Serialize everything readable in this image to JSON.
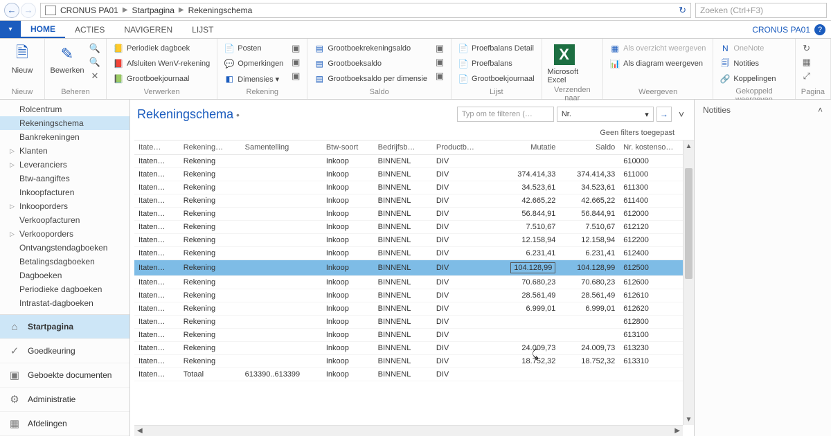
{
  "titlebar": {
    "company": "CRONUS PA01",
    "crumbs": [
      "Startpagina",
      "Rekeningschema"
    ],
    "search_placeholder": "Zoeken (Ctrl+F3)"
  },
  "tabs": {
    "menu": "▾",
    "items": [
      "HOME",
      "ACTIES",
      "NAVIGEREN",
      "LIJST"
    ],
    "right_company": "CRONUS PA01"
  },
  "ribbon": {
    "groups": [
      {
        "label": "Nieuw",
        "big": [
          {
            "icon": "🗎",
            "text": "Nieuw"
          }
        ]
      },
      {
        "label": "Beheren",
        "big": [
          {
            "icon": "✎",
            "text": "Bewerken"
          }
        ],
        "icons": [
          "🔍",
          "🔍",
          "✕"
        ]
      },
      {
        "label": "Verwerken",
        "small": [
          {
            "icon": "📒",
            "text": "Periodiek dagboek"
          },
          {
            "icon": "📕",
            "text": "Afsluiten WenV-rekening"
          },
          {
            "icon": "📗",
            "text": "Grootboekjournaal"
          }
        ]
      },
      {
        "label": "Rekening",
        "small": [
          {
            "icon": "📄",
            "text": "Posten"
          },
          {
            "icon": "💬",
            "text": "Opmerkingen"
          },
          {
            "icon": "◧",
            "text": "Dimensies ▾"
          }
        ],
        "icons": [
          "▣",
          "▣",
          "▣"
        ]
      },
      {
        "label": "Saldo",
        "small": [
          {
            "icon": "▤",
            "text": "Grootboekrekeningsaldo"
          },
          {
            "icon": "▤",
            "text": "Grootboeksaldo"
          },
          {
            "icon": "▤",
            "text": "Grootboeksaldo per dimensie"
          }
        ],
        "icons": [
          "▣",
          "▣",
          "▣"
        ]
      },
      {
        "label": "Lijst",
        "small": [
          {
            "icon": "📄",
            "text": "Proefbalans Detail"
          },
          {
            "icon": "📄",
            "text": "Proefbalans"
          },
          {
            "icon": "📄",
            "text": "Grootboekjournaal"
          }
        ]
      },
      {
        "label": "Verzenden naar",
        "big": [
          {
            "icon": "X",
            "text": "Microsoft Excel",
            "excel": true
          }
        ]
      },
      {
        "label": "Weergeven",
        "small": [
          {
            "icon": "▦",
            "text": "Als overzicht weergeven",
            "dim": true
          },
          {
            "icon": "📊",
            "text": "Als diagram weergeven"
          }
        ]
      },
      {
        "label": "Gekoppeld weergeven",
        "small": [
          {
            "icon": "N",
            "text": "OneNote",
            "dim": true
          },
          {
            "icon": "🗐",
            "text": "Notities"
          },
          {
            "icon": "🔗",
            "text": "Koppelingen"
          }
        ]
      },
      {
        "label": "Pagina",
        "iconsCol": [
          "↻",
          "▦",
          "⤢"
        ]
      }
    ]
  },
  "sidebar": {
    "items": [
      {
        "label": "Rolcentrum"
      },
      {
        "label": "Rekeningschema",
        "sel": true
      },
      {
        "label": "Bankrekeningen"
      },
      {
        "label": "Klanten",
        "caret": true
      },
      {
        "label": "Leveranciers",
        "caret": true
      },
      {
        "label": "Btw-aangiftes"
      },
      {
        "label": "Inkoopfacturen"
      },
      {
        "label": "Inkooporders",
        "caret": true
      },
      {
        "label": "Verkoopfacturen"
      },
      {
        "label": "Verkooporders",
        "caret": true
      },
      {
        "label": "Ontvangstendagboeken"
      },
      {
        "label": "Betalingsdagboeken"
      },
      {
        "label": "Dagboeken"
      },
      {
        "label": "Periodieke dagboeken"
      },
      {
        "label": "Intrastat-dagboeken"
      }
    ],
    "bottom": [
      {
        "icon": "⌂",
        "label": "Startpagina",
        "sel": true
      },
      {
        "icon": "✓",
        "label": "Goedkeuring"
      },
      {
        "icon": "▣",
        "label": "Geboekte documenten"
      },
      {
        "icon": "⚙",
        "label": "Administratie"
      },
      {
        "icon": "▦",
        "label": "Afdelingen"
      }
    ]
  },
  "page": {
    "title": "Rekeningschema",
    "filter_placeholder": "Typ om te filteren (…",
    "filter_field": "Nr.",
    "no_filters": "Geen filters toegepast"
  },
  "columns": [
    "Itate…",
    "Rekening…",
    "Samentelling",
    "Btw-soort",
    "Bedrijfsb…",
    "Productb…",
    "Mutatie",
    "Saldo",
    "Nr. kostenso…"
  ],
  "rows": [
    {
      "c": [
        "Itaten…",
        "Rekening",
        "",
        "Inkoop",
        "BINNENL",
        "DIV",
        "",
        "",
        "610000"
      ]
    },
    {
      "c": [
        "Itaten…",
        "Rekening",
        "",
        "Inkoop",
        "BINNENL",
        "DIV",
        "374.414,33",
        "374.414,33",
        "611000"
      ]
    },
    {
      "c": [
        "Itaten…",
        "Rekening",
        "",
        "Inkoop",
        "BINNENL",
        "DIV",
        "34.523,61",
        "34.523,61",
        "611300"
      ]
    },
    {
      "c": [
        "Itaten…",
        "Rekening",
        "",
        "Inkoop",
        "BINNENL",
        "DIV",
        "42.665,22",
        "42.665,22",
        "611400"
      ]
    },
    {
      "c": [
        "Itaten…",
        "Rekening",
        "",
        "Inkoop",
        "BINNENL",
        "DIV",
        "56.844,91",
        "56.844,91",
        "612000"
      ]
    },
    {
      "c": [
        "Itaten…",
        "Rekening",
        "",
        "Inkoop",
        "BINNENL",
        "DIV",
        "7.510,67",
        "7.510,67",
        "612120"
      ]
    },
    {
      "c": [
        "Itaten…",
        "Rekening",
        "",
        "Inkoop",
        "BINNENL",
        "DIV",
        "12.158,94",
        "12.158,94",
        "612200"
      ]
    },
    {
      "c": [
        "Itaten…",
        "Rekening",
        "",
        "Inkoop",
        "BINNENL",
        "DIV",
        "6.231,41",
        "6.231,41",
        "612400"
      ]
    },
    {
      "c": [
        "Itaten…",
        "Rekening",
        "",
        "Inkoop",
        "BINNENL",
        "DIV",
        "104.128,99",
        "104.128,99",
        "612500"
      ],
      "sel": true,
      "focus": 6
    },
    {
      "c": [
        "Itaten…",
        "Rekening",
        "",
        "Inkoop",
        "BINNENL",
        "DIV",
        "70.680,23",
        "70.680,23",
        "612600"
      ]
    },
    {
      "c": [
        "Itaten…",
        "Rekening",
        "",
        "Inkoop",
        "BINNENL",
        "DIV",
        "28.561,49",
        "28.561,49",
        "612610"
      ]
    },
    {
      "c": [
        "Itaten…",
        "Rekening",
        "",
        "Inkoop",
        "BINNENL",
        "DIV",
        "6.999,01",
        "6.999,01",
        "612620"
      ]
    },
    {
      "c": [
        "Itaten…",
        "Rekening",
        "",
        "Inkoop",
        "BINNENL",
        "DIV",
        "",
        "",
        "612800"
      ]
    },
    {
      "c": [
        "Itaten…",
        "Rekening",
        "",
        "Inkoop",
        "BINNENL",
        "DIV",
        "",
        "",
        "613100"
      ]
    },
    {
      "c": [
        "Itaten…",
        "Rekening",
        "",
        "Inkoop",
        "BINNENL",
        "DIV",
        "24.009,73",
        "24.009,73",
        "613230"
      ]
    },
    {
      "c": [
        "Itaten…",
        "Rekening",
        "",
        "Inkoop",
        "BINNENL",
        "DIV",
        "18.752,32",
        "18.752,32",
        "613310"
      ]
    },
    {
      "c": [
        "Itaten…",
        "Totaal",
        "613390..613399",
        "Inkoop",
        "BINNENL",
        "DIV",
        "",
        "",
        ""
      ]
    }
  ],
  "factbox": {
    "title": "Notities"
  }
}
